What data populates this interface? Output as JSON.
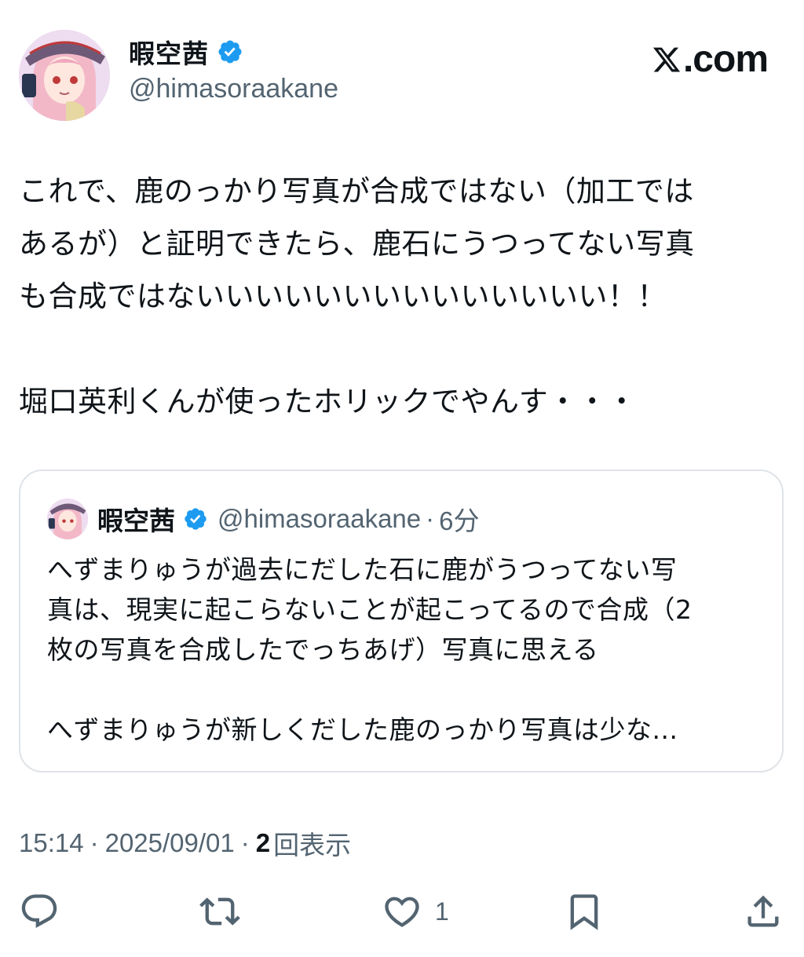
{
  "brand": {
    "logo_icon": "x-logo-icon",
    "text": ".com"
  },
  "author": {
    "display_name": "暇空茜",
    "handle": "@himasoraakane",
    "verified": true,
    "verified_color": "#1d9bf0"
  },
  "post": {
    "text": "これで、鹿のっかり写真が合成ではない（加工では\nあるが）と証明できたら、鹿石にうつってない写真\nも合成ではないいいいいいいいいいいいいい！！\n\n堀口英利くんが使ったホリックでやんす・・・"
  },
  "quoted_post": {
    "display_name": "暇空茜",
    "handle": "@himasoraakane",
    "separator": "·",
    "time": "6分",
    "text": "へずまりゅうが過去にだした石に鹿がうつってない写\n真は、現実に起こらないことが起こってるので合成（2\n枚の写真を合成したでっちあげ）写真に思える\n\nへずまりゅうが新しくだした鹿のっかり写真は少な..."
  },
  "meta": {
    "time": "15:14",
    "separator": "·",
    "date": "2025/09/01",
    "views_count": "2",
    "views_label": "回表示"
  },
  "actions": {
    "reply_icon": "reply-icon",
    "retweet_icon": "retweet-icon",
    "like_icon": "heart-icon",
    "like_count": "1",
    "bookmark_icon": "bookmark-icon",
    "share_icon": "share-icon"
  },
  "colors": {
    "text": "#0f1419",
    "secondary": "#536471",
    "border": "#dfe3e7",
    "verified": "#1d9bf0"
  }
}
